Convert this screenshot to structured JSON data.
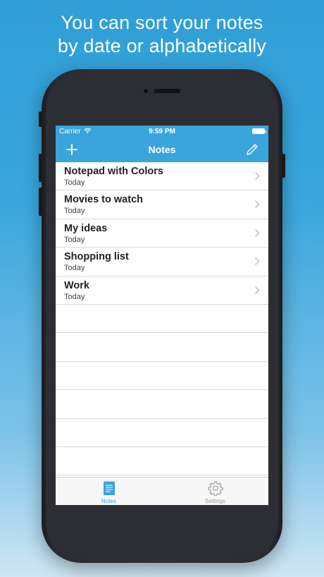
{
  "headline": {
    "line1": "You can sort your notes",
    "line2": "by date or alphabetically"
  },
  "status_bar": {
    "carrier": "Carrier",
    "time": "9:59 PM"
  },
  "nav": {
    "title": "Notes",
    "left_icon": "plus-icon",
    "right_icon": "pencil-icon"
  },
  "notes": [
    {
      "title": "Notepad with Colors",
      "date": "Today"
    },
    {
      "title": "Movies to watch",
      "date": "Today"
    },
    {
      "title": "My ideas",
      "date": "Today"
    },
    {
      "title": "Shopping list",
      "date": "Today"
    },
    {
      "title": "Work",
      "date": "Today"
    }
  ],
  "tabs": [
    {
      "label": "Notes",
      "icon": "notepad-icon",
      "active": true
    },
    {
      "label": "Settings",
      "icon": "gear-icon",
      "active": false
    }
  ],
  "colors": {
    "accent": "#3aa4dc",
    "tab_active": "#3aa4dc",
    "tab_inactive": "#9a9a9e"
  }
}
